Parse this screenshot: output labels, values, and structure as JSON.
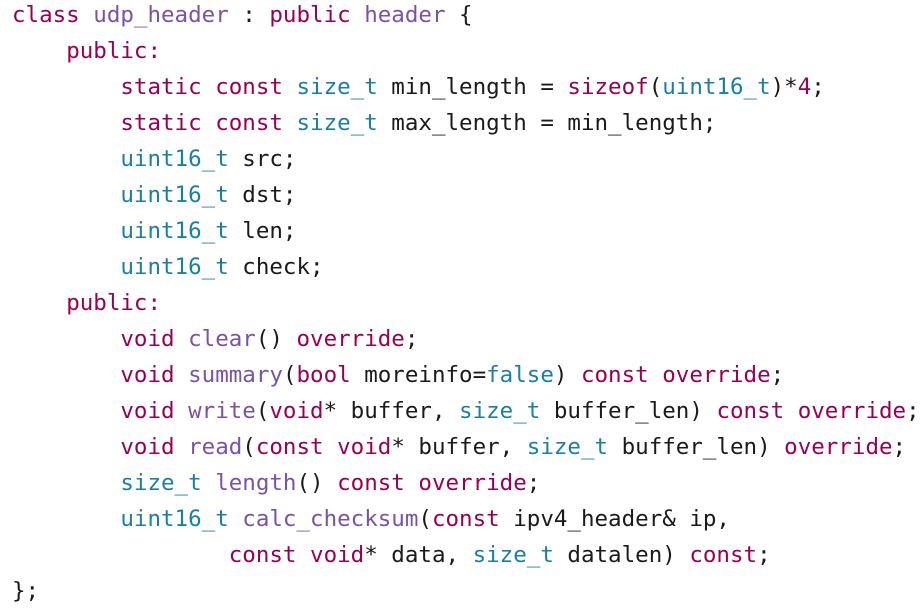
{
  "colors": {
    "keyword": "#990055",
    "type": "#1a7fa8",
    "function": "#7a52a8",
    "class_name": "#7a52a8",
    "plain": "#1a1a1a",
    "number": "#990055",
    "background": "#ffffff"
  },
  "lines": [
    [
      {
        "t": "class",
        "c": "keyword"
      },
      {
        "t": " udp_header ",
        "c": "class_name"
      },
      {
        "t": ": ",
        "c": "plain"
      },
      {
        "t": "public",
        "c": "keyword"
      },
      {
        "t": " header ",
        "c": "class_name"
      },
      {
        "t": "{",
        "c": "plain"
      }
    ],
    [
      {
        "t": "    ",
        "c": "plain"
      },
      {
        "t": "public:",
        "c": "keyword"
      }
    ],
    [
      {
        "t": "        ",
        "c": "plain"
      },
      {
        "t": "static",
        "c": "keyword"
      },
      {
        "t": " ",
        "c": "plain"
      },
      {
        "t": "const",
        "c": "keyword"
      },
      {
        "t": " ",
        "c": "plain"
      },
      {
        "t": "size_t",
        "c": "type"
      },
      {
        "t": " min_length = ",
        "c": "plain"
      },
      {
        "t": "sizeof",
        "c": "keyword"
      },
      {
        "t": "(",
        "c": "plain"
      },
      {
        "t": "uint16_t",
        "c": "type"
      },
      {
        "t": ")*",
        "c": "plain"
      },
      {
        "t": "4",
        "c": "number"
      },
      {
        "t": ";",
        "c": "plain"
      }
    ],
    [
      {
        "t": "        ",
        "c": "plain"
      },
      {
        "t": "static",
        "c": "keyword"
      },
      {
        "t": " ",
        "c": "plain"
      },
      {
        "t": "const",
        "c": "keyword"
      },
      {
        "t": " ",
        "c": "plain"
      },
      {
        "t": "size_t",
        "c": "type"
      },
      {
        "t": " max_length = min_length;",
        "c": "plain"
      }
    ],
    [
      {
        "t": "        ",
        "c": "plain"
      },
      {
        "t": "uint16_t",
        "c": "type"
      },
      {
        "t": " src;",
        "c": "plain"
      }
    ],
    [
      {
        "t": "        ",
        "c": "plain"
      },
      {
        "t": "uint16_t",
        "c": "type"
      },
      {
        "t": " dst;",
        "c": "plain"
      }
    ],
    [
      {
        "t": "        ",
        "c": "plain"
      },
      {
        "t": "uint16_t",
        "c": "type"
      },
      {
        "t": " len;",
        "c": "plain"
      }
    ],
    [
      {
        "t": "        ",
        "c": "plain"
      },
      {
        "t": "uint16_t",
        "c": "type"
      },
      {
        "t": " check;",
        "c": "plain"
      }
    ],
    [
      {
        "t": "    ",
        "c": "plain"
      },
      {
        "t": "public:",
        "c": "keyword"
      }
    ],
    [
      {
        "t": "        ",
        "c": "plain"
      },
      {
        "t": "void",
        "c": "keyword"
      },
      {
        "t": " ",
        "c": "plain"
      },
      {
        "t": "clear",
        "c": "function"
      },
      {
        "t": "() ",
        "c": "plain"
      },
      {
        "t": "override",
        "c": "keyword"
      },
      {
        "t": ";",
        "c": "plain"
      }
    ],
    [
      {
        "t": "        ",
        "c": "plain"
      },
      {
        "t": "void",
        "c": "keyword"
      },
      {
        "t": " ",
        "c": "plain"
      },
      {
        "t": "summary",
        "c": "function"
      },
      {
        "t": "(",
        "c": "plain"
      },
      {
        "t": "bool",
        "c": "keyword"
      },
      {
        "t": " moreinfo=",
        "c": "plain"
      },
      {
        "t": "false",
        "c": "type"
      },
      {
        "t": ") ",
        "c": "plain"
      },
      {
        "t": "const",
        "c": "keyword"
      },
      {
        "t": " ",
        "c": "plain"
      },
      {
        "t": "override",
        "c": "keyword"
      },
      {
        "t": ";",
        "c": "plain"
      }
    ],
    [
      {
        "t": "        ",
        "c": "plain"
      },
      {
        "t": "void",
        "c": "keyword"
      },
      {
        "t": " ",
        "c": "plain"
      },
      {
        "t": "write",
        "c": "function"
      },
      {
        "t": "(",
        "c": "plain"
      },
      {
        "t": "void",
        "c": "keyword"
      },
      {
        "t": "* buffer, ",
        "c": "plain"
      },
      {
        "t": "size_t",
        "c": "type"
      },
      {
        "t": " buffer_len) ",
        "c": "plain"
      },
      {
        "t": "const",
        "c": "keyword"
      },
      {
        "t": " ",
        "c": "plain"
      },
      {
        "t": "override",
        "c": "keyword"
      },
      {
        "t": ";",
        "c": "plain"
      }
    ],
    [
      {
        "t": "        ",
        "c": "plain"
      },
      {
        "t": "void",
        "c": "keyword"
      },
      {
        "t": " ",
        "c": "plain"
      },
      {
        "t": "read",
        "c": "function"
      },
      {
        "t": "(",
        "c": "plain"
      },
      {
        "t": "const",
        "c": "keyword"
      },
      {
        "t": " ",
        "c": "plain"
      },
      {
        "t": "void",
        "c": "keyword"
      },
      {
        "t": "* buffer, ",
        "c": "plain"
      },
      {
        "t": "size_t",
        "c": "type"
      },
      {
        "t": " buffer_len) ",
        "c": "plain"
      },
      {
        "t": "override",
        "c": "keyword"
      },
      {
        "t": ";",
        "c": "plain"
      }
    ],
    [
      {
        "t": "        ",
        "c": "plain"
      },
      {
        "t": "size_t",
        "c": "type"
      },
      {
        "t": " ",
        "c": "plain"
      },
      {
        "t": "length",
        "c": "function"
      },
      {
        "t": "() ",
        "c": "plain"
      },
      {
        "t": "const",
        "c": "keyword"
      },
      {
        "t": " ",
        "c": "plain"
      },
      {
        "t": "override",
        "c": "keyword"
      },
      {
        "t": ";",
        "c": "plain"
      }
    ],
    [
      {
        "t": "        ",
        "c": "plain"
      },
      {
        "t": "uint16_t",
        "c": "type"
      },
      {
        "t": " ",
        "c": "plain"
      },
      {
        "t": "calc_checksum",
        "c": "function"
      },
      {
        "t": "(",
        "c": "plain"
      },
      {
        "t": "const",
        "c": "keyword"
      },
      {
        "t": " ipv4_header& ip,",
        "c": "plain"
      }
    ],
    [
      {
        "t": "                ",
        "c": "plain"
      },
      {
        "t": "const",
        "c": "keyword"
      },
      {
        "t": " ",
        "c": "plain"
      },
      {
        "t": "void",
        "c": "keyword"
      },
      {
        "t": "* data, ",
        "c": "plain"
      },
      {
        "t": "size_t",
        "c": "type"
      },
      {
        "t": " datalen) ",
        "c": "plain"
      },
      {
        "t": "const",
        "c": "keyword"
      },
      {
        "t": ";",
        "c": "plain"
      }
    ],
    [
      {
        "t": "};",
        "c": "plain"
      }
    ]
  ]
}
